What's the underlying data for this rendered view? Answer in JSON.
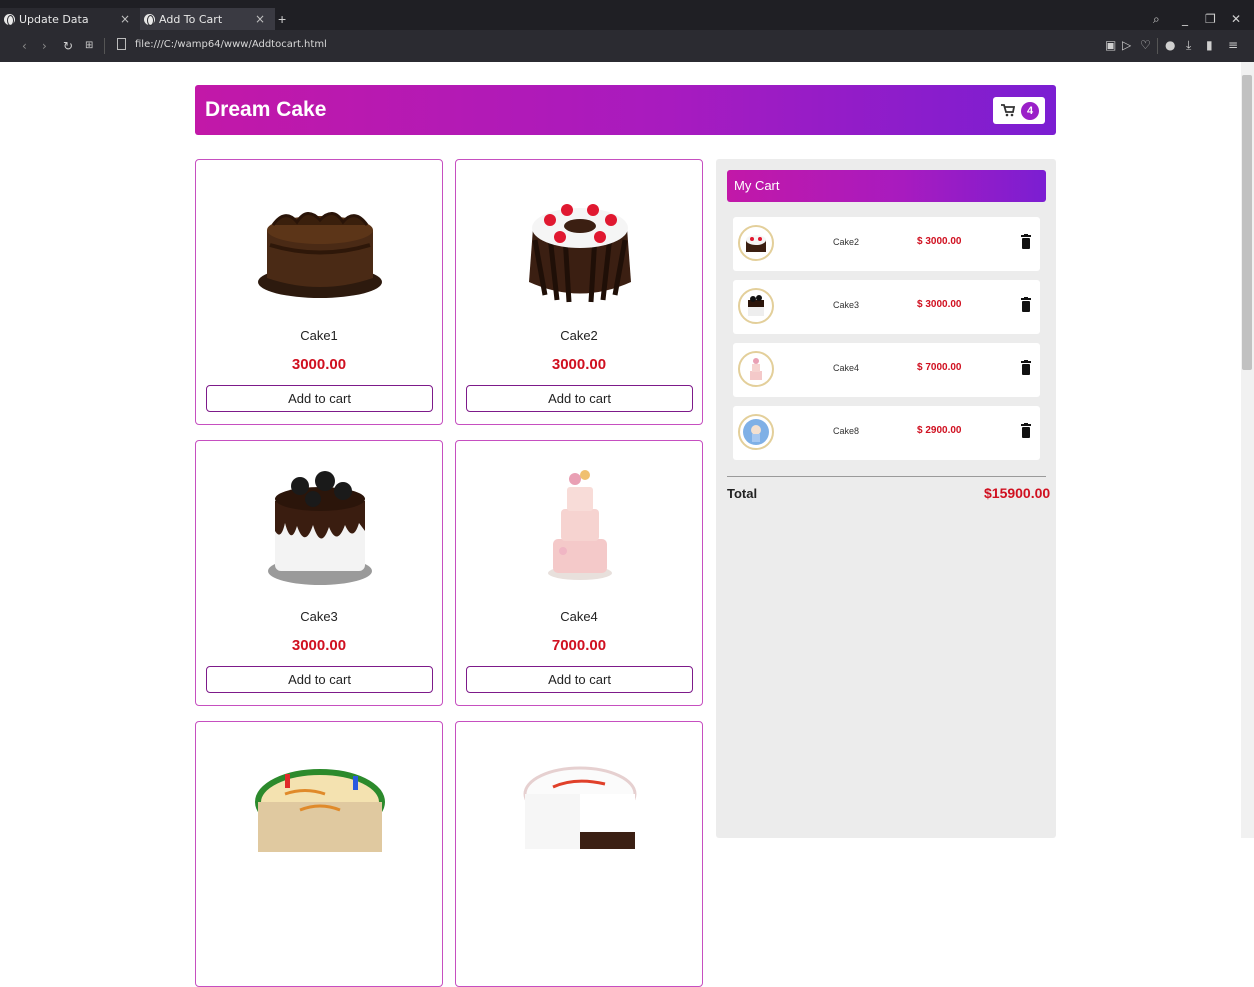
{
  "browser": {
    "tabs": [
      {
        "label": "Update Data"
      },
      {
        "label": "Add To Cart"
      }
    ],
    "url": "file:///C:/wamp64/www/Addtocart.html",
    "new_tab_symbol": "+",
    "close_symbol": "×"
  },
  "header": {
    "brand": "Dream Cake",
    "cart_count": "4"
  },
  "products": [
    {
      "name": "Cake1",
      "price": "3000.00",
      "button": "Add to cart"
    },
    {
      "name": "Cake2",
      "price": "3000.00",
      "button": "Add to cart"
    },
    {
      "name": "Cake3",
      "price": "3000.00",
      "button": "Add to cart"
    },
    {
      "name": "Cake4",
      "price": "7000.00",
      "button": "Add to cart"
    },
    {
      "name": "",
      "price": "",
      "button": ""
    },
    {
      "name": "",
      "price": "",
      "button": ""
    }
  ],
  "cart": {
    "title": "My Cart",
    "items": [
      {
        "name": "Cake2",
        "price": "$ 3000.00"
      },
      {
        "name": "Cake3",
        "price": "$ 3000.00"
      },
      {
        "name": "Cake4",
        "price": "$ 7000.00"
      },
      {
        "name": "Cake8",
        "price": "$ 2900.00"
      }
    ],
    "total_label": "Total",
    "total_value": "$15900.00"
  },
  "colors": {
    "accent_start": "#c218a8",
    "accent_end": "#7b1ed2",
    "price_red": "#d01020",
    "card_border": "#c64fc0"
  },
  "icons": [
    "globe-icon",
    "cart-icon",
    "trash-icon",
    "cake-image"
  ]
}
